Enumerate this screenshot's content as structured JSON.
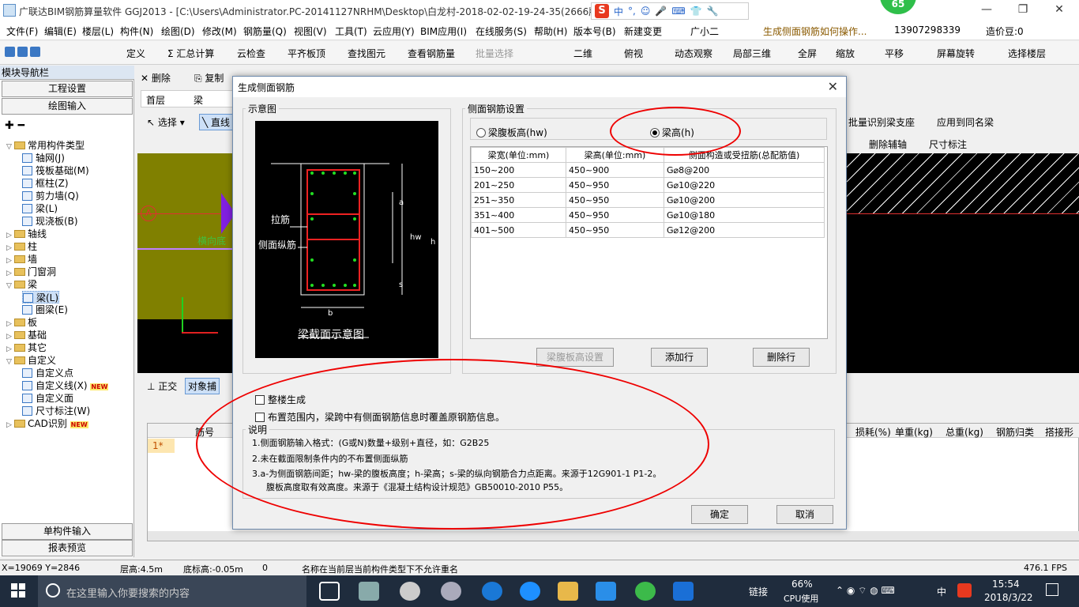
{
  "window": {
    "title": "广联达BIM钢筋算量软件 GGJ2013 - [C:\\Users\\Administrator.PC-20141127NRHM\\Desktop\\白龙村-2018-02-02-19-24-35(2666版",
    "ime": {
      "label_s": "S",
      "items": [
        "中",
        "°,",
        "☺",
        "🎤",
        "⌨",
        "👕",
        "🔧"
      ]
    },
    "badge_count": "65",
    "controls": {
      "minimize": "—",
      "maximize": "❐",
      "close": "✕"
    }
  },
  "menu": [
    "文件(F)",
    "编辑(E)",
    "楼层(L)",
    "构件(N)",
    "绘图(D)",
    "修改(M)",
    "钢筋量(Q)",
    "视图(V)",
    "工具(T)",
    "云应用(Y)",
    "BIM应用(I)",
    "在线服务(S)",
    "帮助(H)",
    "版本号(B)",
    "新建变更",
    "广小二",
    "生成侧面钢筋如何操作...",
    "13907298339",
    "造价豆:0"
  ],
  "toolbar1": [
    "定义",
    "Σ 汇总计算",
    "云检查",
    "平齐板顶",
    "查找图元",
    "查看钢筋量",
    "批量选择",
    "二维",
    "俯视",
    "动态观察",
    "局部三维",
    "全屏",
    "缩放",
    "平移",
    "屏幕旋转",
    "选择楼层"
  ],
  "left_panel": {
    "header": "模块导航栏",
    "btn_project": "工程设置",
    "btn_draw": "绘图输入",
    "tree": [
      {
        "label": "常用构件类型",
        "type": "folder",
        "level": 0,
        "exp": "▽"
      },
      {
        "label": "轴网(J)",
        "type": "leaf",
        "level": 1
      },
      {
        "label": "筏板基础(M)",
        "type": "leaf",
        "level": 1
      },
      {
        "label": "框柱(Z)",
        "type": "leaf",
        "level": 1
      },
      {
        "label": "剪力墙(Q)",
        "type": "leaf",
        "level": 1
      },
      {
        "label": "梁(L)",
        "type": "leaf",
        "level": 1
      },
      {
        "label": "现浇板(B)",
        "type": "leaf",
        "level": 1
      },
      {
        "label": "轴线",
        "type": "folder",
        "level": 0,
        "exp": "▷"
      },
      {
        "label": "柱",
        "type": "folder",
        "level": 0,
        "exp": "▷"
      },
      {
        "label": "墙",
        "type": "folder",
        "level": 0,
        "exp": "▷"
      },
      {
        "label": "门窗洞",
        "type": "folder",
        "level": 0,
        "exp": "▷"
      },
      {
        "label": "梁",
        "type": "folder",
        "level": 0,
        "exp": "▽"
      },
      {
        "label": "梁(L)",
        "type": "leaf",
        "level": 1,
        "selected": true
      },
      {
        "label": "圈梁(E)",
        "type": "leaf",
        "level": 1
      },
      {
        "label": "板",
        "type": "folder",
        "level": 0,
        "exp": "▷"
      },
      {
        "label": "基础",
        "type": "folder",
        "level": 0,
        "exp": "▷"
      },
      {
        "label": "其它",
        "type": "folder",
        "level": 0,
        "exp": "▷"
      },
      {
        "label": "自定义",
        "type": "folder",
        "level": 0,
        "exp": "▽"
      },
      {
        "label": "自定义点",
        "type": "leaf",
        "level": 1
      },
      {
        "label": "自定义线(X)",
        "type": "leaf",
        "level": 1,
        "new": true
      },
      {
        "label": "自定义面",
        "type": "leaf",
        "level": 1
      },
      {
        "label": "尺寸标注(W)",
        "type": "leaf",
        "level": 1
      },
      {
        "label": "CAD识别",
        "type": "folder",
        "level": 0,
        "exp": "▷",
        "new": true
      }
    ],
    "new_badge": "NEW",
    "btn_single": "单构件输入",
    "btn_report": "报表预览"
  },
  "work": {
    "toolbar2": [
      "删除",
      "复制"
    ],
    "floor": "首层",
    "component": "梁",
    "select": "选择",
    "line_tool": "直线",
    "right_tools": [
      "批量识别梁支座",
      "应用到同名梁",
      "删除辅轴",
      "尺寸标注"
    ],
    "axis_label": "A",
    "canvas_text": "横向底",
    "ortho": "正交",
    "snap": "对象捕",
    "grid_headers_left": [
      "筋号"
    ],
    "grid_headers_right": [
      "损耗(%)",
      "单重(kg)",
      "总重(kg)",
      "钢筋归类",
      "搭接形"
    ],
    "row_marker": "1*"
  },
  "dialog": {
    "title": "生成侧面钢筋",
    "schema_group": "示意图",
    "schema": {
      "tie": "拉筋",
      "side_bar": "侧面纵筋",
      "caption": "梁截面示意图",
      "dim_a": "a",
      "dim_s": "s",
      "dim_hw": "hw",
      "dim_h": "h",
      "dim_b": "b"
    },
    "settings_group": "侧面钢筋设置",
    "radio_hw": "梁腹板高(hw)",
    "radio_h": "梁高(h)",
    "radio_selected": "h",
    "table": {
      "headers": [
        "梁宽(单位:mm)",
        "梁高(单位:mm)",
        "侧面构造或受扭筋(总配筋值)"
      ],
      "rows": [
        [
          "150~200",
          "450~900",
          "G⌀8@200"
        ],
        [
          "201~250",
          "450~950",
          "G⌀10@220"
        ],
        [
          "251~350",
          "450~950",
          "G⌀10@200"
        ],
        [
          "351~400",
          "450~950",
          "G⌀10@180"
        ],
        [
          "401~500",
          "450~950",
          "G⌀12@200"
        ]
      ]
    },
    "btn_web_height": "梁腹板高设置",
    "btn_add_row": "添加行",
    "btn_delete_row": "删除行",
    "chk_whole": "整楼生成",
    "chk_override": "布置范围内，梁跨中有侧面钢筋信息时覆盖原钢筋信息。",
    "notes_title": "说明",
    "notes": [
      "1.侧面钢筋输入格式：(G或N)数量+级别+直径，如：G2B25",
      "2.未在截面限制条件内的不布置侧面纵筋",
      "3.a-为侧面钢筋间距；hw-梁的腹板高度；h-梁高；s-梁的纵向钢筋合力点距离。来源于12G901-1 P1-2。",
      "腹板高度取有效高度。来源于《混凝土结构设计规范》GB50010-2010 P55。"
    ],
    "ok": "确定",
    "cancel": "取消"
  },
  "status": {
    "coords": "X=19069 Y=2846",
    "floor_height": "层高:4.5m",
    "base_height": "底标高:-0.05m",
    "zero": "0",
    "message": "名称在当前层当前构件类型下不允许重名",
    "fps": "476.1 FPS"
  },
  "taskbar": {
    "search_placeholder": "在这里输入你要搜索的内容",
    "link": "链接",
    "cpu_value": "66%",
    "cpu_label": "CPU使用",
    "lang": "中",
    "time": "15:54",
    "date": "2018/3/22"
  },
  "colors": {
    "annotation": "#e00000",
    "folder": "#e8c15c",
    "accent": "#3b78c4"
  }
}
